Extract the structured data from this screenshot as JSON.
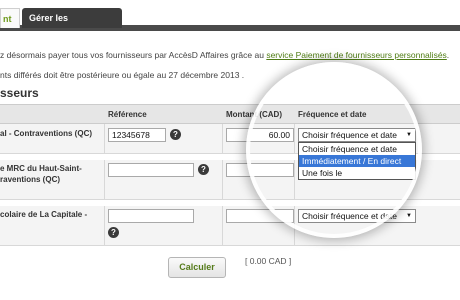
{
  "tabs": [
    {
      "label": "nt",
      "active": true
    },
    {
      "label": "Gérer les fournisseurs",
      "active": false
    }
  ],
  "info": {
    "line1_prefix": "z désormais payer tous vos fournisseurs par AccèsD Affaires grâce au ",
    "line1_link": "service Paiement de fournisseurs personnalisés",
    "line1_suffix": ".",
    "line2": "nts différés doit être postérieure ou égale au 27 décembre 2013 ."
  },
  "section_title": "sseurs",
  "table": {
    "headers": {
      "reference": "Référence",
      "amount": "Montant (CAD)",
      "frequency": "Fréquence et date"
    },
    "rows": [
      {
        "payee_lines": [
          "al - Contraventions (QC)"
        ],
        "reference": "12345678",
        "amount": "60.00",
        "frequency": "Choisir fréquence et date"
      },
      {
        "payee_lines": [
          "e MRC du Haut-Saint-",
          "raventions (QC)"
        ],
        "reference": "",
        "amount": "",
        "frequency": "Choisir fréquence et date"
      },
      {
        "payee_lines": [
          "colaire de La Capitale -"
        ],
        "reference": "",
        "amount": "",
        "frequency": "Choisir fréquence et date"
      }
    ]
  },
  "dropdown_options": [
    {
      "label": "Choisir fréquence et date",
      "selected": false
    },
    {
      "label": "Immédiatement / En direct",
      "selected": true
    },
    {
      "label": "Une fois le",
      "selected": false
    }
  ],
  "help_glyph": "?",
  "caret_glyph": "▼",
  "calculate_label": "Calculer",
  "total": "[ 0.00 CAD ]",
  "colors": {
    "accent_green": "#6e9a1c",
    "link_green": "#4f7c14",
    "tab_dark": "#3c3c3c",
    "selection_blue": "#3877d7"
  }
}
